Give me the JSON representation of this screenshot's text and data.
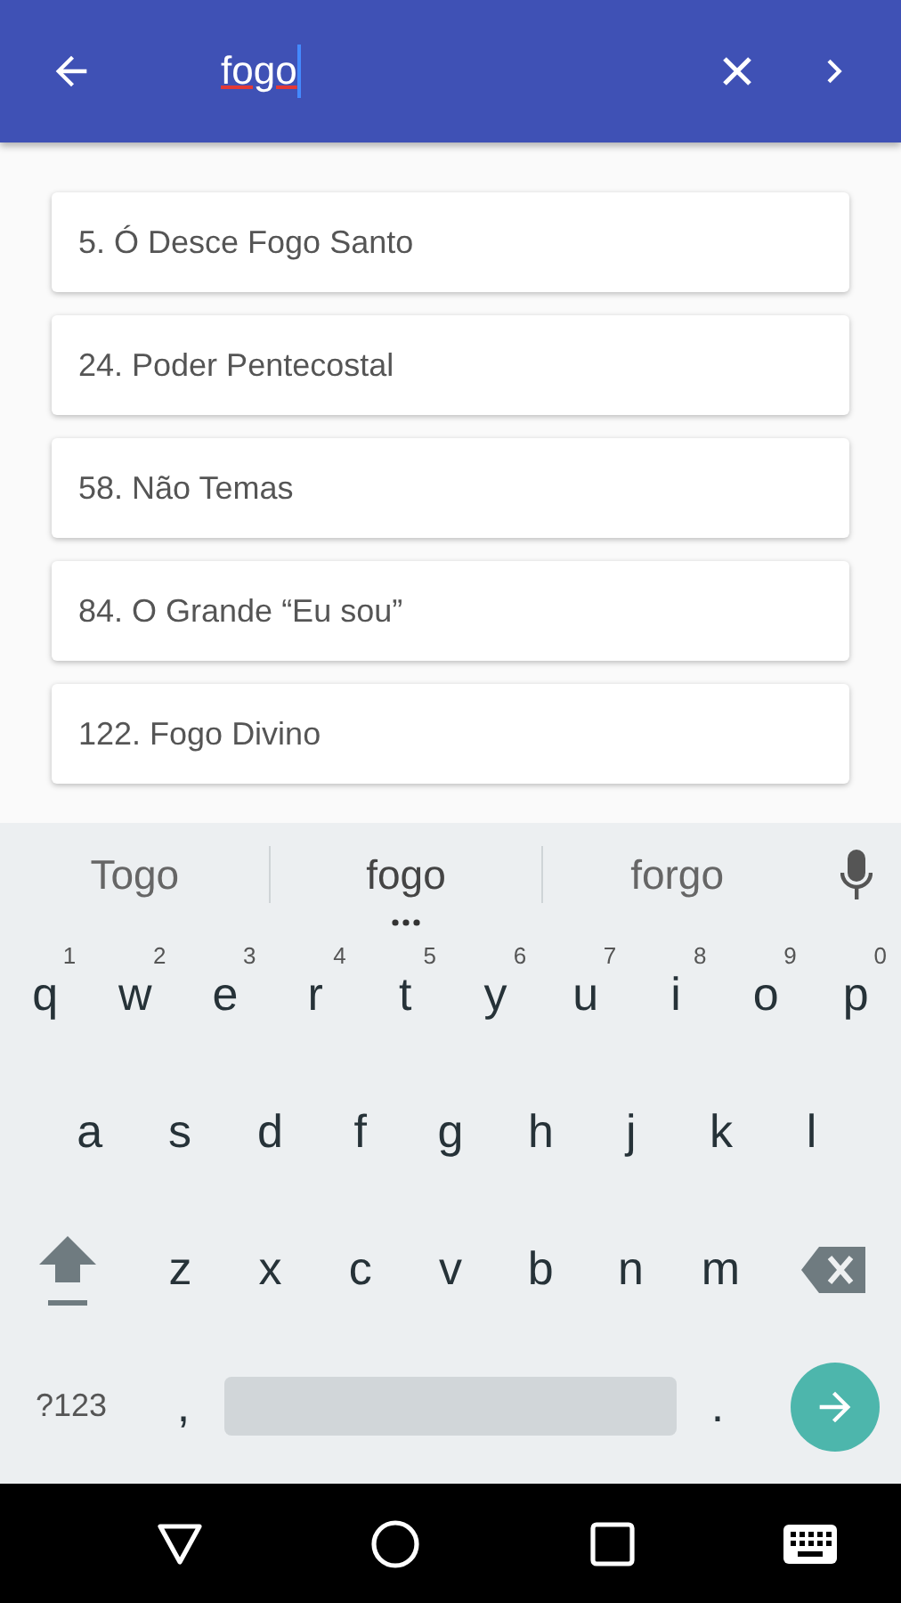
{
  "app_bar": {
    "search_value": "fogo"
  },
  "results": [
    {
      "title": "5. Ó Desce Fogo Santo"
    },
    {
      "title": "24. Poder Pentecostal"
    },
    {
      "title": "58. Não Temas"
    },
    {
      "title": "84. O Grande “Eu sou”"
    },
    {
      "title": "122. Fogo Divino"
    }
  ],
  "keyboard": {
    "suggestions": [
      {
        "text": "Togo",
        "selected": false
      },
      {
        "text": "fogo",
        "selected": true
      },
      {
        "text": "forgo",
        "selected": false
      }
    ],
    "row_1": [
      {
        "key": "q",
        "hint": "1"
      },
      {
        "key": "w",
        "hint": "2"
      },
      {
        "key": "e",
        "hint": "3"
      },
      {
        "key": "r",
        "hint": "4"
      },
      {
        "key": "t",
        "hint": "5"
      },
      {
        "key": "y",
        "hint": "6"
      },
      {
        "key": "u",
        "hint": "7"
      },
      {
        "key": "i",
        "hint": "8"
      },
      {
        "key": "o",
        "hint": "9"
      },
      {
        "key": "p",
        "hint": "0"
      }
    ],
    "row_2": [
      "a",
      "s",
      "d",
      "f",
      "g",
      "h",
      "j",
      "k",
      "l"
    ],
    "row_3": [
      "z",
      "x",
      "c",
      "v",
      "b",
      "n",
      "m"
    ],
    "symbols_key": "?123",
    "comma_key": ",",
    "period_key": "."
  }
}
